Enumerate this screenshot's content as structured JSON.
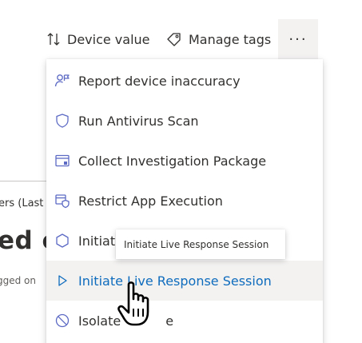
{
  "commandbar": {
    "device_value": {
      "label": "Device value",
      "icon": "sort-arrows-icon"
    },
    "manage_tags": {
      "label": "Manage tags",
      "icon": "tag-icon"
    },
    "more": {
      "label": "···",
      "icon": "more-ellipsis-icon"
    }
  },
  "background": {
    "filter_text": "ers (Last",
    "heading": "ed c",
    "subtext": "gged on"
  },
  "menu": {
    "items": [
      {
        "label": "Report device inaccuracy",
        "icon": "report-person-icon"
      },
      {
        "label": "Run Antivirus Scan",
        "icon": "shield-icon"
      },
      {
        "label": "Collect Investigation Package",
        "icon": "package-icon"
      },
      {
        "label": "Restrict App Execution",
        "icon": "restrict-app-icon"
      },
      {
        "label": "Initiate",
        "icon": "hexagon-icon"
      },
      {
        "label": "Initiate Live Response Session",
        "icon": "play-icon"
      },
      {
        "label": "Isolate",
        "icon": "block-icon",
        "suffix": "e"
      }
    ]
  },
  "tooltip": {
    "text": "Initiate Live Response Session"
  },
  "colors": {
    "accent": "#0f6cbd",
    "hover_bg": "#f3f2f1",
    "text": "#323130"
  }
}
